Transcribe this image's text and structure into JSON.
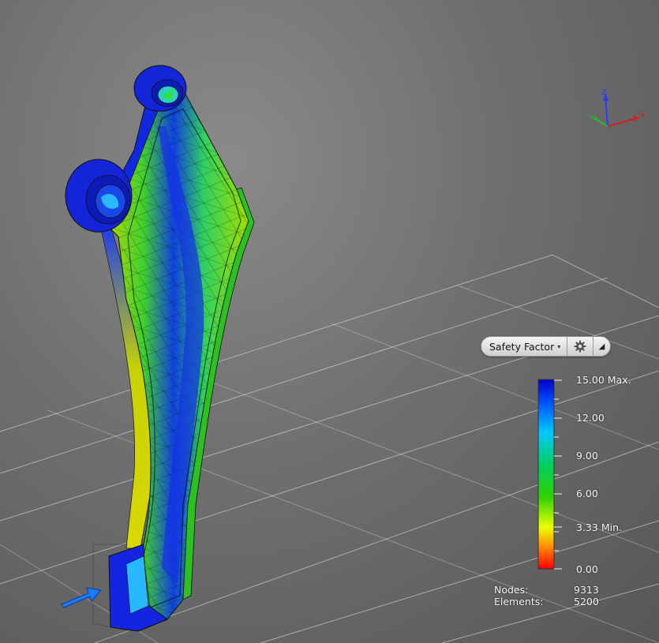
{
  "legend": {
    "result_type": "Safety Factor",
    "ticks": [
      {
        "value": "15.00",
        "suffix": " Max."
      },
      {
        "value": "12.00",
        "suffix": ""
      },
      {
        "value": "9.00",
        "suffix": ""
      },
      {
        "value": "6.00",
        "suffix": ""
      },
      {
        "value": "3.33",
        "suffix": " Min."
      },
      {
        "value": "0.00",
        "suffix": ""
      }
    ],
    "colors": [
      "#0000d8",
      "#00c8ff",
      "#00d000",
      "#e8ff00",
      "#ffb000",
      "#ff1000"
    ]
  },
  "stats": {
    "nodes_label": "Nodes:",
    "nodes_value": "9313",
    "elements_label": "Elements:",
    "elements_value": "5200"
  },
  "triad": {
    "z": "Z",
    "y": "Y",
    "x": "X"
  },
  "icons": [
    "gear-icon",
    "collapse-triangle-icon",
    "load-arrow-icon"
  ]
}
